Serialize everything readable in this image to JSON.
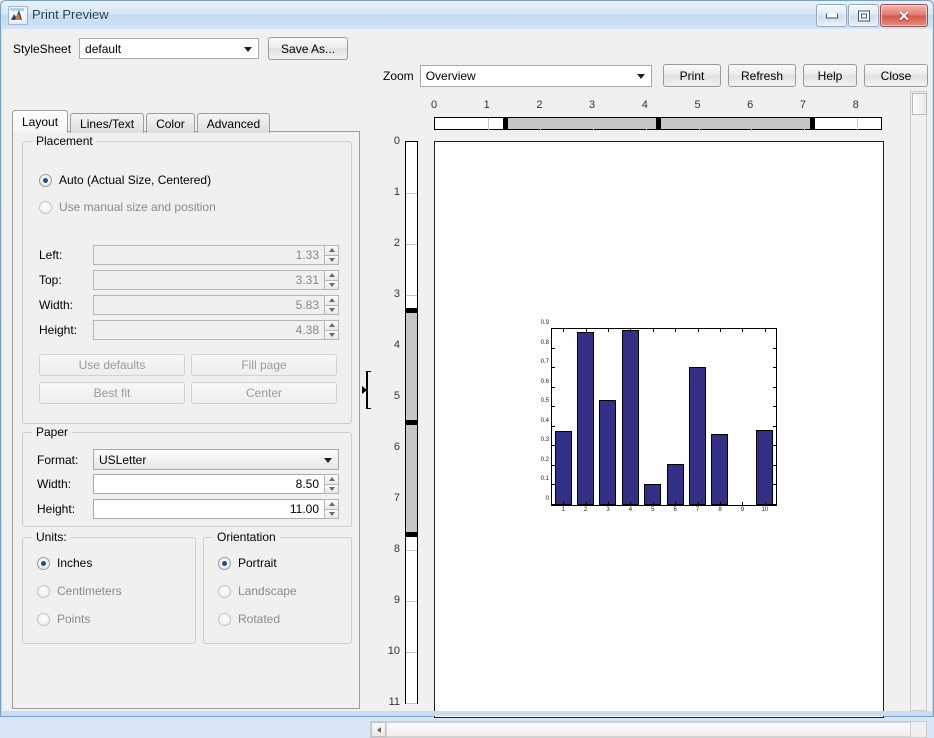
{
  "window": {
    "title": "Print Preview",
    "icon": "matlab-figure-icon",
    "buttons": {
      "minimize": "minimize-icon",
      "maximize": "maximize-icon",
      "close": "✕"
    }
  },
  "toolbar": {
    "stylesheet_label": "StyleSheet",
    "stylesheet_value": "default",
    "save_as_label": "Save As...",
    "zoom_label": "Zoom",
    "zoom_value": "Overview",
    "print_label": "Print",
    "refresh_label": "Refresh",
    "help_label": "Help",
    "close_label": "Close"
  },
  "tabs": [
    {
      "label": "Layout",
      "active": true
    },
    {
      "label": "Lines/Text",
      "active": false
    },
    {
      "label": "Color",
      "active": false
    },
    {
      "label": "Advanced",
      "active": false
    }
  ],
  "placement": {
    "title": "Placement",
    "auto_label": "Auto (Actual Size, Centered)",
    "manual_label": "Use manual size and position",
    "selected": "auto",
    "fields": [
      {
        "label": "Left:",
        "value": "1.33",
        "enabled": false
      },
      {
        "label": "Top:",
        "value": "3.31",
        "enabled": false
      },
      {
        "label": "Width:",
        "value": "5.83",
        "enabled": false
      },
      {
        "label": "Height:",
        "value": "4.38",
        "enabled": false
      }
    ],
    "buttons": [
      {
        "label": "Use defaults",
        "enabled": false
      },
      {
        "label": "Fill page",
        "enabled": false
      },
      {
        "label": "Best fit",
        "enabled": false
      },
      {
        "label": "Center",
        "enabled": false
      }
    ]
  },
  "paper": {
    "title": "Paper",
    "format_label": "Format:",
    "format_value": "USLetter",
    "width_label": "Width:",
    "width_value": "8.50",
    "height_label": "Height:",
    "height_value": "11.00"
  },
  "units": {
    "title": "Units:",
    "options": [
      "Inches",
      "Centimeters",
      "Points"
    ],
    "selected": "Inches"
  },
  "orientation": {
    "title": "Orientation",
    "options": [
      "Portrait",
      "Landscape",
      "Rotated"
    ],
    "selected": "Portrait"
  },
  "rulers": {
    "horizontal": {
      "ticks": [
        "0",
        "1",
        "2",
        "3",
        "4",
        "5",
        "6",
        "7",
        "8"
      ],
      "max": 8.5,
      "band_start": 1.33,
      "band_end": 7.16
    },
    "vertical": {
      "ticks": [
        "0",
        "1",
        "2",
        "3",
        "4",
        "5",
        "6",
        "7",
        "8",
        "9",
        "10",
        "11"
      ],
      "max": 11,
      "band_start": 3.31,
      "band_end": 7.69,
      "mid_mark": 5.5
    }
  },
  "chart_data": {
    "type": "bar",
    "title": "",
    "xlabel": "",
    "ylabel": "",
    "categories": [
      "1",
      "2",
      "3",
      "4",
      "5",
      "6",
      "7",
      "8",
      "9",
      "10"
    ],
    "values": [
      0.38,
      0.885,
      0.535,
      0.895,
      0.105,
      0.21,
      0.705,
      0.365,
      0.0,
      0.385
    ],
    "ylim": [
      0,
      0.9
    ],
    "yticks": [
      "0",
      "0.1",
      "0.2",
      "0.3",
      "0.4",
      "0.5",
      "0.6",
      "0.7",
      "0.8",
      "0.9"
    ],
    "ytick_values": [
      0,
      0.1,
      0.2,
      0.3,
      0.4,
      0.5,
      0.6,
      0.7,
      0.8,
      0.9
    ],
    "bar_color": "#332f87",
    "edge_color": "#000000",
    "grid": false,
    "legend": null
  },
  "scrollbars": {
    "vertical": "vertical-scrollbar",
    "horizontal": "horizontal-scrollbar",
    "left_arrow": "◀",
    "right_arrow": "▶"
  }
}
